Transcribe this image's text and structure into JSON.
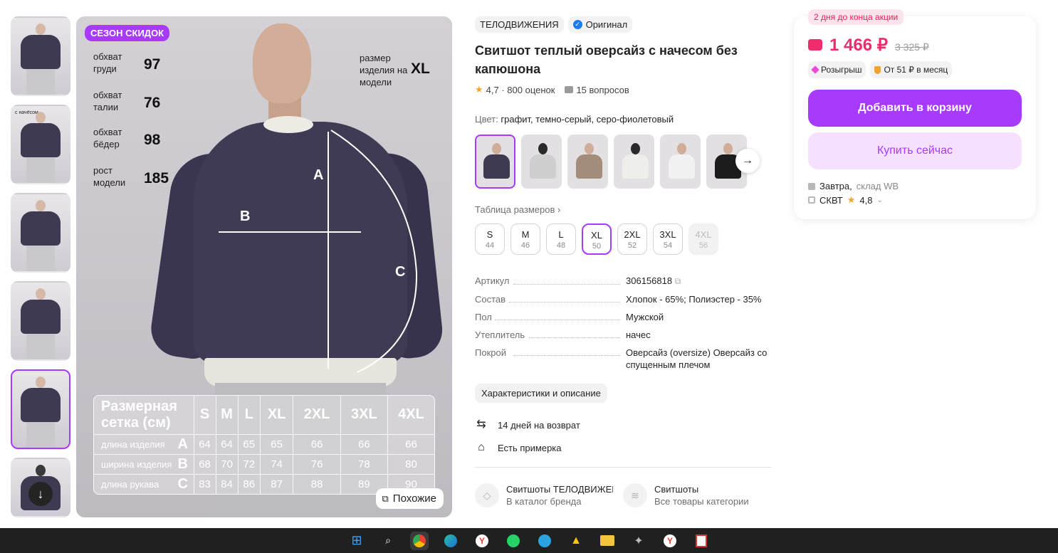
{
  "gallery": {
    "sale_badge": "СЕЗОН СКИДОК",
    "measurements": [
      {
        "label": "обхват груди",
        "value": "97"
      },
      {
        "label": "обхват талии",
        "value": "76"
      },
      {
        "label": "обхват бёдер",
        "value": "98"
      },
      {
        "label": "рост модели",
        "value": "185"
      }
    ],
    "model_size_label": "размер изделия на модели",
    "model_size_value": "XL",
    "marks": {
      "a": "A",
      "b": "B",
      "c": "C"
    },
    "size_grid": {
      "title": "Размерная сетка (см)",
      "sizes": [
        "S",
        "M",
        "L",
        "XL",
        "2XL",
        "3XL",
        "4XL"
      ],
      "rows": [
        {
          "label": "длина изделия",
          "key": "A",
          "values": [
            "64",
            "64",
            "65",
            "65",
            "66",
            "66",
            "66"
          ]
        },
        {
          "label": "ширина изделия",
          "key": "B",
          "values": [
            "68",
            "70",
            "72",
            "74",
            "76",
            "78",
            "80"
          ]
        },
        {
          "label": "длина рукава",
          "key": "C",
          "values": [
            "83",
            "84",
            "86",
            "87",
            "88",
            "89",
            "90"
          ]
        }
      ]
    },
    "similar_label": "Похожие",
    "thumb_label": "с начёсом"
  },
  "product": {
    "brand": "ТЕЛОДВИЖЕНИЯ",
    "original": "Оригинал",
    "title": "Свитшот теплый оверсайз с начесом без капюшона",
    "rating": "4,7 · 800 оценок",
    "questions": "15 вопросов",
    "color_label": "Цвет:",
    "color_value": "графит, темно-серый, серо-фиолетовый",
    "variant_colors": [
      "#3d3a52",
      "#cfcfcf",
      "#a38c7a",
      "#eeeeea",
      "#f1f1f1",
      "#1c1c1c"
    ],
    "size_table_link": "Таблица размеров ›",
    "sizes": [
      {
        "n": "S",
        "r": "44"
      },
      {
        "n": "M",
        "r": "46"
      },
      {
        "n": "L",
        "r": "48"
      },
      {
        "n": "XL",
        "r": "50"
      },
      {
        "n": "2XL",
        "r": "52"
      },
      {
        "n": "3XL",
        "r": "54"
      },
      {
        "n": "4XL",
        "r": "56"
      }
    ],
    "params": [
      {
        "k": "Артикул",
        "v": "306156818"
      },
      {
        "k": "Состав",
        "v": "Хлопок - 65%; Полиэстер - 35%"
      },
      {
        "k": "Пол",
        "v": "Мужской"
      },
      {
        "k": "Утеплитель",
        "v": "начес"
      },
      {
        "k": "Покрой",
        "v": "Оверсайз (oversize) Оверсайз со спущенным плечом"
      }
    ],
    "char_button": "Характеристики и описание",
    "services": [
      "14 дней на возврат",
      "Есть примерка"
    ],
    "categories": [
      {
        "t1": "Свитшоты ТЕЛОДВИЖЕНИЯ",
        "t2": "В каталог бренда"
      },
      {
        "t1": "Свитшоты",
        "t2": "Все товары категории"
      }
    ]
  },
  "price": {
    "promo_badge": "2 дня до конца акции",
    "now": "1 466 ₽",
    "old": "3 325 ₽",
    "chip_lottery": "Розыгрыш",
    "chip_installment": "От 51 ₽ в месяц",
    "add_to_cart": "Добавить в корзину",
    "buy_now": "Купить сейчас",
    "delivery_day": "Завтра,",
    "delivery_wh": "склад WB",
    "seller": "СКВТ",
    "seller_rating": "4,8"
  },
  "colors": {
    "accent": "#a73afd",
    "price": "#f12c6c"
  }
}
